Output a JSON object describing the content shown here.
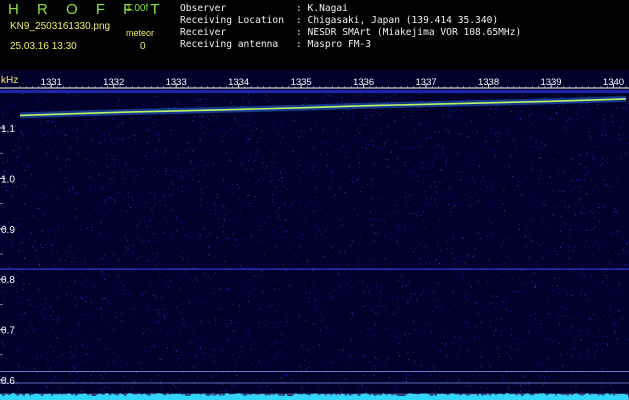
{
  "header": {
    "brand": "H R O F F T",
    "version": "1.00f",
    "filename": "KN9_2503161330.png",
    "meteor_label": "meteor",
    "datetime": "25.03.16 13:30",
    "meteor_count": "0",
    "info": [
      {
        "label": "Observer",
        "value": ": K.Nagai"
      },
      {
        "label": "Receiving Location",
        "value": ": Chigasaki, Japan (139.414 35.340)"
      },
      {
        "label": "Receiver",
        "value": ": NESDR SMArt (Miakejima VOR 108.65MHz)"
      },
      {
        "label": "Receiving antenna",
        "value": ": Maspro FM-3"
      }
    ]
  },
  "colors": {
    "background": "#00002a",
    "noise": "#1f2fff",
    "trace": "#c8ff60",
    "axis_text": "#f2f06a",
    "tick_label": "#ffffff",
    "baseline": "#30d8ff"
  },
  "chart_data": {
    "type": "heatmap",
    "ylabel": "kHz",
    "xlabel": "",
    "x_ticks": [
      "1331",
      "1332",
      "1333",
      "1334",
      "1335",
      "1336",
      "1337",
      "1338",
      "1339",
      "1340"
    ],
    "y_ticks": [
      "1.1",
      "1.0",
      "0.9",
      "0.8",
      "0.7",
      "0.6"
    ],
    "ylim": [
      0.6,
      1.18
    ],
    "xlim": [
      1330.5,
      1340.2
    ],
    "carrier_trace": {
      "x": [
        1330.5,
        1331,
        1332,
        1333,
        1334,
        1335,
        1336,
        1337,
        1338,
        1339,
        1340,
        1340.2
      ],
      "y": [
        1.125,
        1.127,
        1.131,
        1.134,
        1.137,
        1.14,
        1.144,
        1.147,
        1.15,
        1.153,
        1.157,
        1.158
      ]
    },
    "horizontal_lines": [
      0.82,
      0.617,
      0.594,
      0.572
    ]
  }
}
